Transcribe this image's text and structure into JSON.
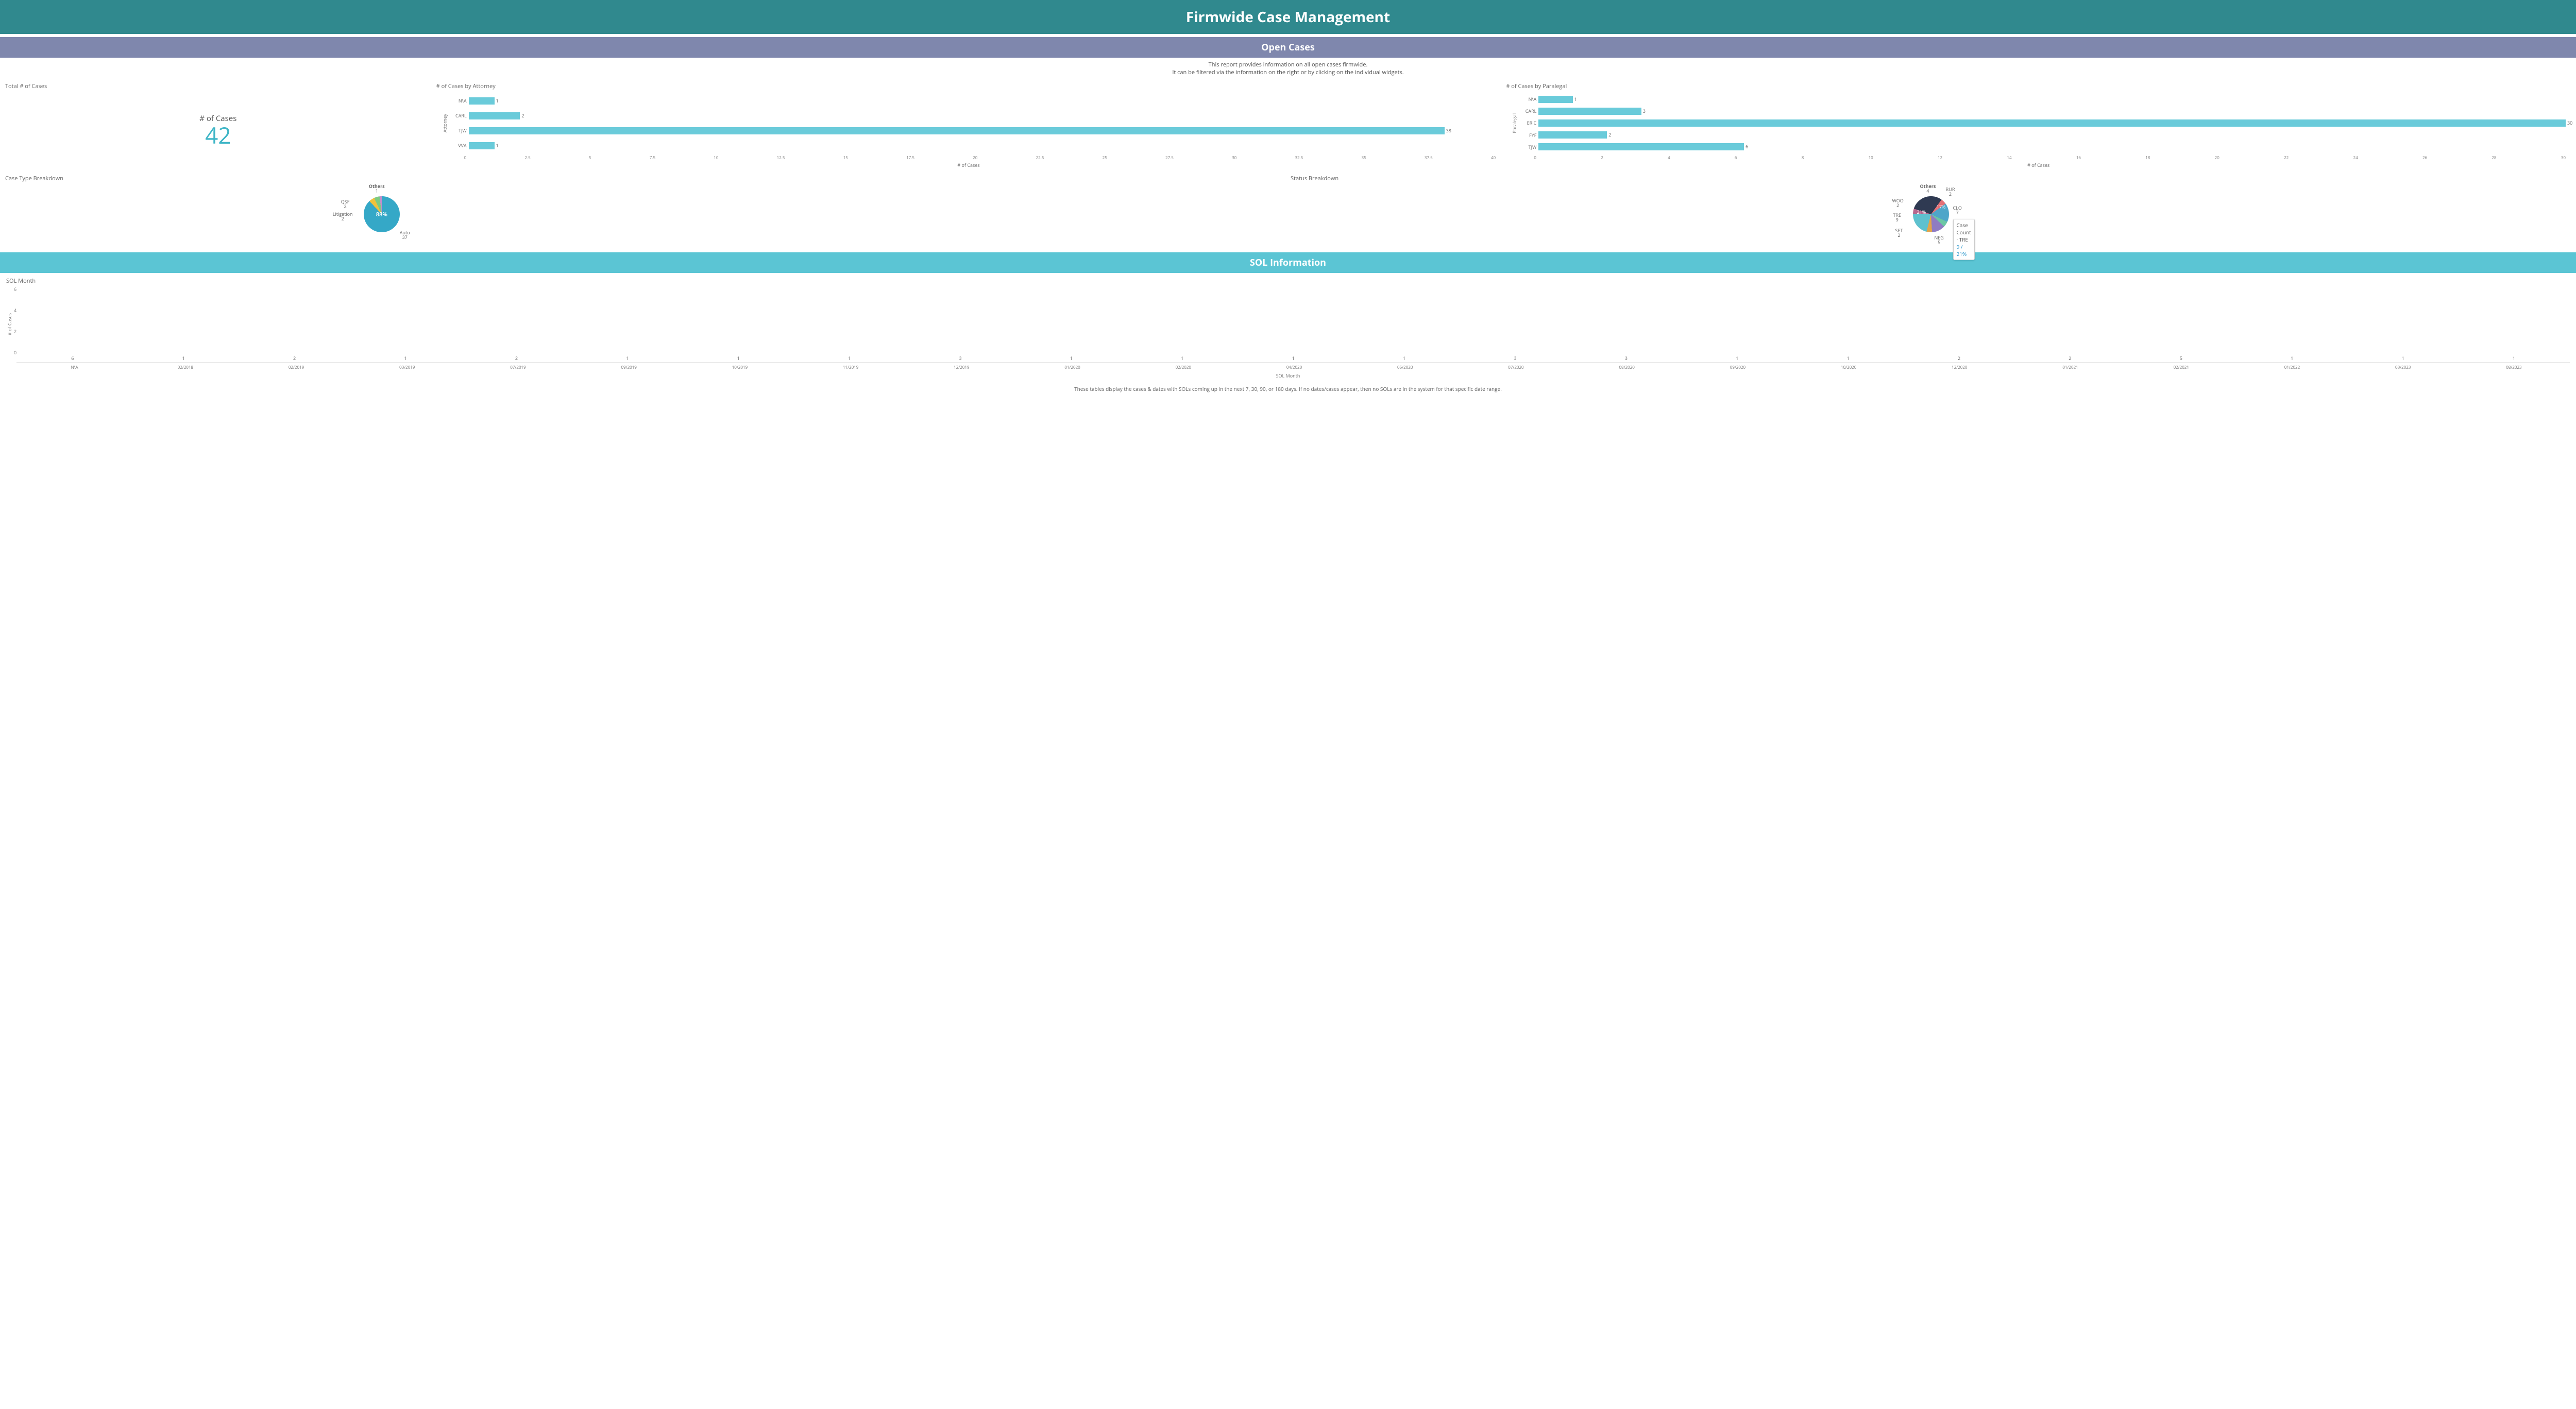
{
  "header": {
    "title": "Firmwide Case Management"
  },
  "open_cases": {
    "section_title": "Open Cases",
    "desc_line1": "This report provides information on all open cases firmwide.",
    "desc_line2": "It can be filtered via the information on the right or by clicking on the individual widgets."
  },
  "kpi": {
    "panel_title": "Total # of Cases",
    "label": "# of Cases",
    "value": "42"
  },
  "attorney_chart": {
    "panel_title": "# of Cases by Attorney",
    "ylabel": "Attorney",
    "xlabel": "# of Cases"
  },
  "paralegal_chart": {
    "panel_title": "# of Cases by Paralegal",
    "ylabel": "Paralegal",
    "xlabel": "# of Cases"
  },
  "casetype": {
    "panel_title": "Case Type Breakdown",
    "center_label": "88%"
  },
  "status": {
    "panel_title": "Status Breakdown",
    "tooltip_line1": "Case Count  ·  TRE",
    "tooltip_line2": "9 / 21%"
  },
  "sol": {
    "section_title": "SOL Information",
    "panel_title": "SOL Month",
    "ylabel": "# of Cases",
    "xlabel": "SOL Month",
    "footer": "These tables display the cases & dates with SOLs coming up in the next 7, 30, 90, or 180 days. If no dates/cases appear, then no SOLs are in the system for that specific date range."
  },
  "chart_data": [
    {
      "id": "cases_by_attorney",
      "type": "bar",
      "orientation": "horizontal",
      "title": "# of Cases by Attorney",
      "xlabel": "# of Cases",
      "ylabel": "Attorney",
      "xlim": [
        0,
        40
      ],
      "xticks": [
        0,
        2.5,
        5,
        7.5,
        10,
        12.5,
        15,
        17.5,
        20,
        22.5,
        25,
        27.5,
        30,
        32.5,
        35,
        37.5,
        40
      ],
      "categories": [
        "N\\A",
        "CARL",
        "TJW",
        "VVA"
      ],
      "values": [
        1,
        2,
        38,
        1
      ]
    },
    {
      "id": "cases_by_paralegal",
      "type": "bar",
      "orientation": "horizontal",
      "title": "# of Cases by Paralegal",
      "xlabel": "# of Cases",
      "ylabel": "Paralegal",
      "xlim": [
        0,
        30
      ],
      "xticks": [
        0,
        2,
        4,
        6,
        8,
        10,
        12,
        14,
        16,
        18,
        20,
        22,
        24,
        26,
        28,
        30
      ],
      "categories": [
        "N\\A",
        "CARL",
        "ERIC",
        "FYF",
        "TJW"
      ],
      "values": [
        1,
        3,
        30,
        2,
        6
      ]
    },
    {
      "id": "case_type_breakdown",
      "type": "pie",
      "title": "Case Type Breakdown",
      "center_label": "88%",
      "slices": [
        {
          "name": "Auto",
          "value": 37,
          "percent": 88
        },
        {
          "name": "Litigation",
          "value": 2,
          "percent": 5
        },
        {
          "name": "QSF",
          "value": 2,
          "percent": 5
        },
        {
          "name": "Others",
          "value": 1,
          "percent": 2
        }
      ]
    },
    {
      "id": "status_breakdown",
      "type": "pie",
      "title": "Status Breakdown",
      "tooltip": {
        "series": "Case Count",
        "category": "TRE",
        "value": 9,
        "percent": 21
      },
      "slices": [
        {
          "name": "TRE",
          "value": 9,
          "percent": 21
        },
        {
          "name": "CLO",
          "value": 7,
          "percent": 17
        },
        {
          "name": "NEG",
          "value": 5,
          "percent": 12
        },
        {
          "name": "Others",
          "value": 4,
          "percent": 10
        },
        {
          "name": "BUR",
          "value": 2,
          "percent": 5
        },
        {
          "name": "WOO",
          "value": 2,
          "percent": 5
        },
        {
          "name": "SET",
          "value": 2,
          "percent": 5
        }
      ]
    },
    {
      "id": "sol_month",
      "type": "bar",
      "orientation": "vertical",
      "title": "SOL Month",
      "xlabel": "SOL Month",
      "ylabel": "# of Cases",
      "ylim": [
        0,
        6
      ],
      "yticks": [
        0,
        2,
        4,
        6
      ],
      "categories": [
        "N\\A",
        "02/2018",
        "02/2019",
        "03/2019",
        "07/2019",
        "09/2019",
        "10/2019",
        "11/2019",
        "12/2019",
        "01/2020",
        "02/2020",
        "04/2020",
        "05/2020",
        "07/2020",
        "08/2020",
        "09/2020",
        "10/2020",
        "12/2020",
        "01/2021",
        "02/2021",
        "01/2022",
        "03/2023",
        "08/2023"
      ],
      "values": [
        6,
        1,
        2,
        1,
        2,
        1,
        1,
        1,
        3,
        1,
        1,
        1,
        1,
        3,
        3,
        1,
        1,
        2,
        2,
        5,
        1,
        1,
        1
      ]
    }
  ]
}
